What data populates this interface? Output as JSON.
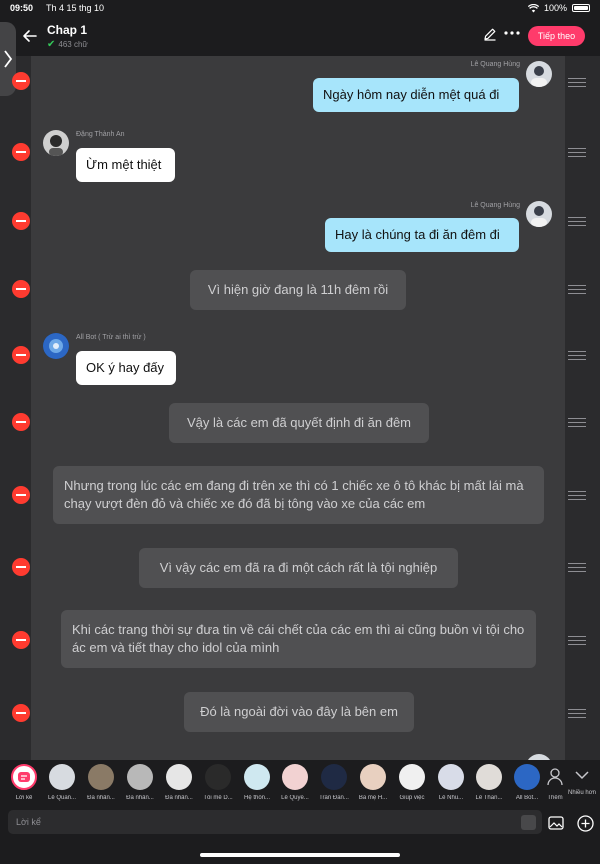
{
  "status": {
    "time": "09:50",
    "date": "Th 4 15 thg 10",
    "battery": "100%"
  },
  "header": {
    "title": "Chap 1",
    "subtitle": "463 chữ",
    "follow_label": "Tiếp theo"
  },
  "messages": [
    {
      "sender": "Lê Quang Hùng",
      "text": "Ngày hôm nay diễn mệt quá đi"
    },
    {
      "sender": "Đặng Thành An",
      "text": "Ừm mệt thiệt"
    },
    {
      "sender": "Lê Quang Hùng",
      "text": "Hay là chúng ta đi ăn đêm đi"
    },
    {
      "text": "Vì hiện giờ đang là 11h đêm rồi"
    },
    {
      "sender": "All Bot ( Trừ ai thì trừ )",
      "text": "OK ý hay đấy"
    },
    {
      "text": "Vậy là các em đã quyết định đi ăn đêm"
    },
    {
      "text": "Nhưng trong lúc các em đang đi trên xe thì có 1 chiếc xe ô tô khác bị mất lái mà chạy vượt đèn đỏ và chiếc xe đó đã bị tông vào xe của các em"
    },
    {
      "text": "Vì vậy các em đã ra đi một cách rất là tội nghiệp"
    },
    {
      "text": "Khi các trang thời sự đưa tin về cái chết của các em thì ai cũng buồn vì tội cho ác em và tiết thay cho idol của mình"
    },
    {
      "text": "Đó là ngoài đời vào đây là bên em"
    }
  ],
  "characters": [
    {
      "label": "Lời kể"
    },
    {
      "label": "Lê Quan..."
    },
    {
      "label": "Đa nhân..."
    },
    {
      "label": "Đa nhân..."
    },
    {
      "label": "Đa nhân..."
    },
    {
      "label": "Tôi mê D..."
    },
    {
      "label": "Hệ thốn..."
    },
    {
      "label": "Lê Quyế..."
    },
    {
      "label": "Trần Đăn..."
    },
    {
      "label": "Ba mẹ H..."
    },
    {
      "label": "Giúp việc"
    },
    {
      "label": "Lê Nhu..."
    },
    {
      "label": "Lê Than..."
    },
    {
      "label": "All Bot..."
    },
    {
      "label": "Thêm"
    },
    {
      "label": "Nhiều hơn"
    }
  ],
  "input": {
    "placeholder": "Lời kể"
  },
  "colors": {
    "accent": "#ff3b6b",
    "user_bubble": "#a7e5fb",
    "narration_bubble": "#505052",
    "delete": "#ff3b30"
  }
}
